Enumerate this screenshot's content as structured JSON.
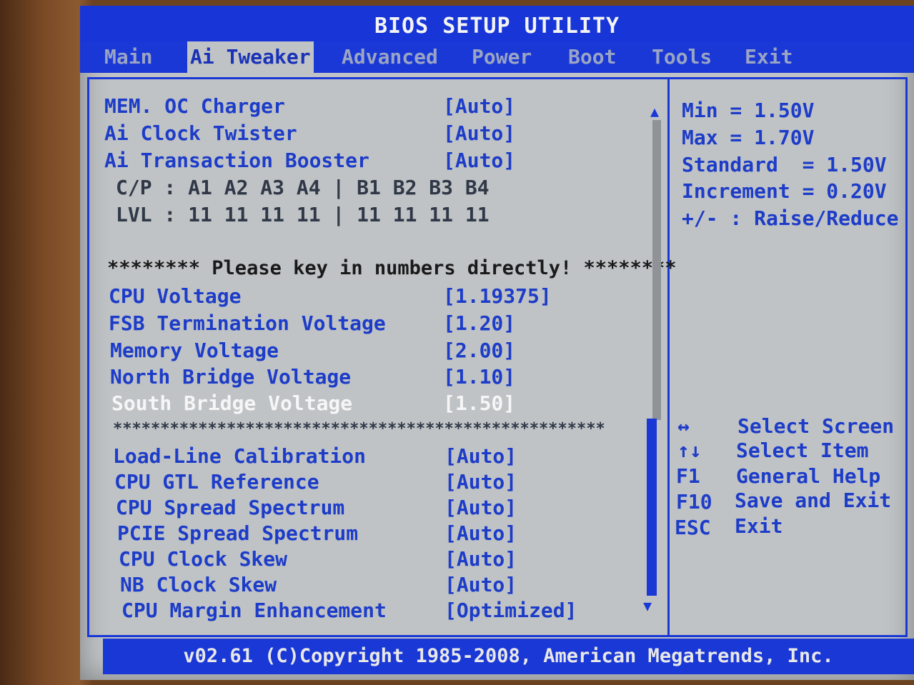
{
  "title": "BIOS SETUP UTILITY",
  "tabs": [
    "Main",
    "Ai Tweaker",
    "Advanced",
    "Power",
    "Boot",
    "Tools",
    "Exit"
  ],
  "settings_top": [
    {
      "label": "MEM. OC Charger",
      "value": "[Auto]"
    },
    {
      "label": "Ai Clock Twister",
      "value": "[Auto]"
    },
    {
      "label": "Ai Transaction Booster",
      "value": "[Auto]"
    }
  ],
  "cp_line": "C/P : A1 A2 A3 A4 | B1 B2 B3 B4",
  "lvl_line": "LVL : 11 11 11 11 | 11 11 11 11",
  "notice": "******** Please key in numbers directly! ********",
  "voltages": [
    {
      "label": "CPU Voltage",
      "value": "[1.19375]"
    },
    {
      "label": "FSB Termination Voltage",
      "value": "[1.20]"
    },
    {
      "label": "Memory Voltage",
      "value": "[2.00]"
    },
    {
      "label": "North Bridge Voltage",
      "value": "[1.10]"
    },
    {
      "label": "South Bridge Voltage",
      "value": "[1.50]"
    }
  ],
  "separator": "****************************************************",
  "settings_bottom": [
    {
      "label": "Load-Line Calibration",
      "value": "[Auto]"
    },
    {
      "label": "CPU GTL Reference",
      "value": "[Auto]"
    },
    {
      "label": "CPU Spread Spectrum",
      "value": "[Auto]"
    },
    {
      "label": "PCIE Spread Spectrum",
      "value": "[Auto]"
    },
    {
      "label": "CPU Clock Skew",
      "value": "[Auto]"
    },
    {
      "label": "NB Clock Skew",
      "value": "[Auto]"
    },
    {
      "label": "CPU Margin Enhancement",
      "value": "[Optimized]"
    }
  ],
  "help": [
    "Min = 1.50V",
    "Max = 1.70V",
    "Standard  = 1.50V",
    "Increment = 0.20V",
    "+/- : Raise/Reduce"
  ],
  "legend": [
    {
      "key": "↔",
      "action": "Select Screen"
    },
    {
      "key": "↑↓",
      "action": "Select Item"
    },
    {
      "key": "F1",
      "action": "General Help"
    },
    {
      "key": "F10",
      "action": "Save and Exit"
    },
    {
      "key": "ESC",
      "action": "Exit"
    }
  ],
  "footer": "v02.61 (C)Copyright 1985-2008, American Megatrends, Inc."
}
